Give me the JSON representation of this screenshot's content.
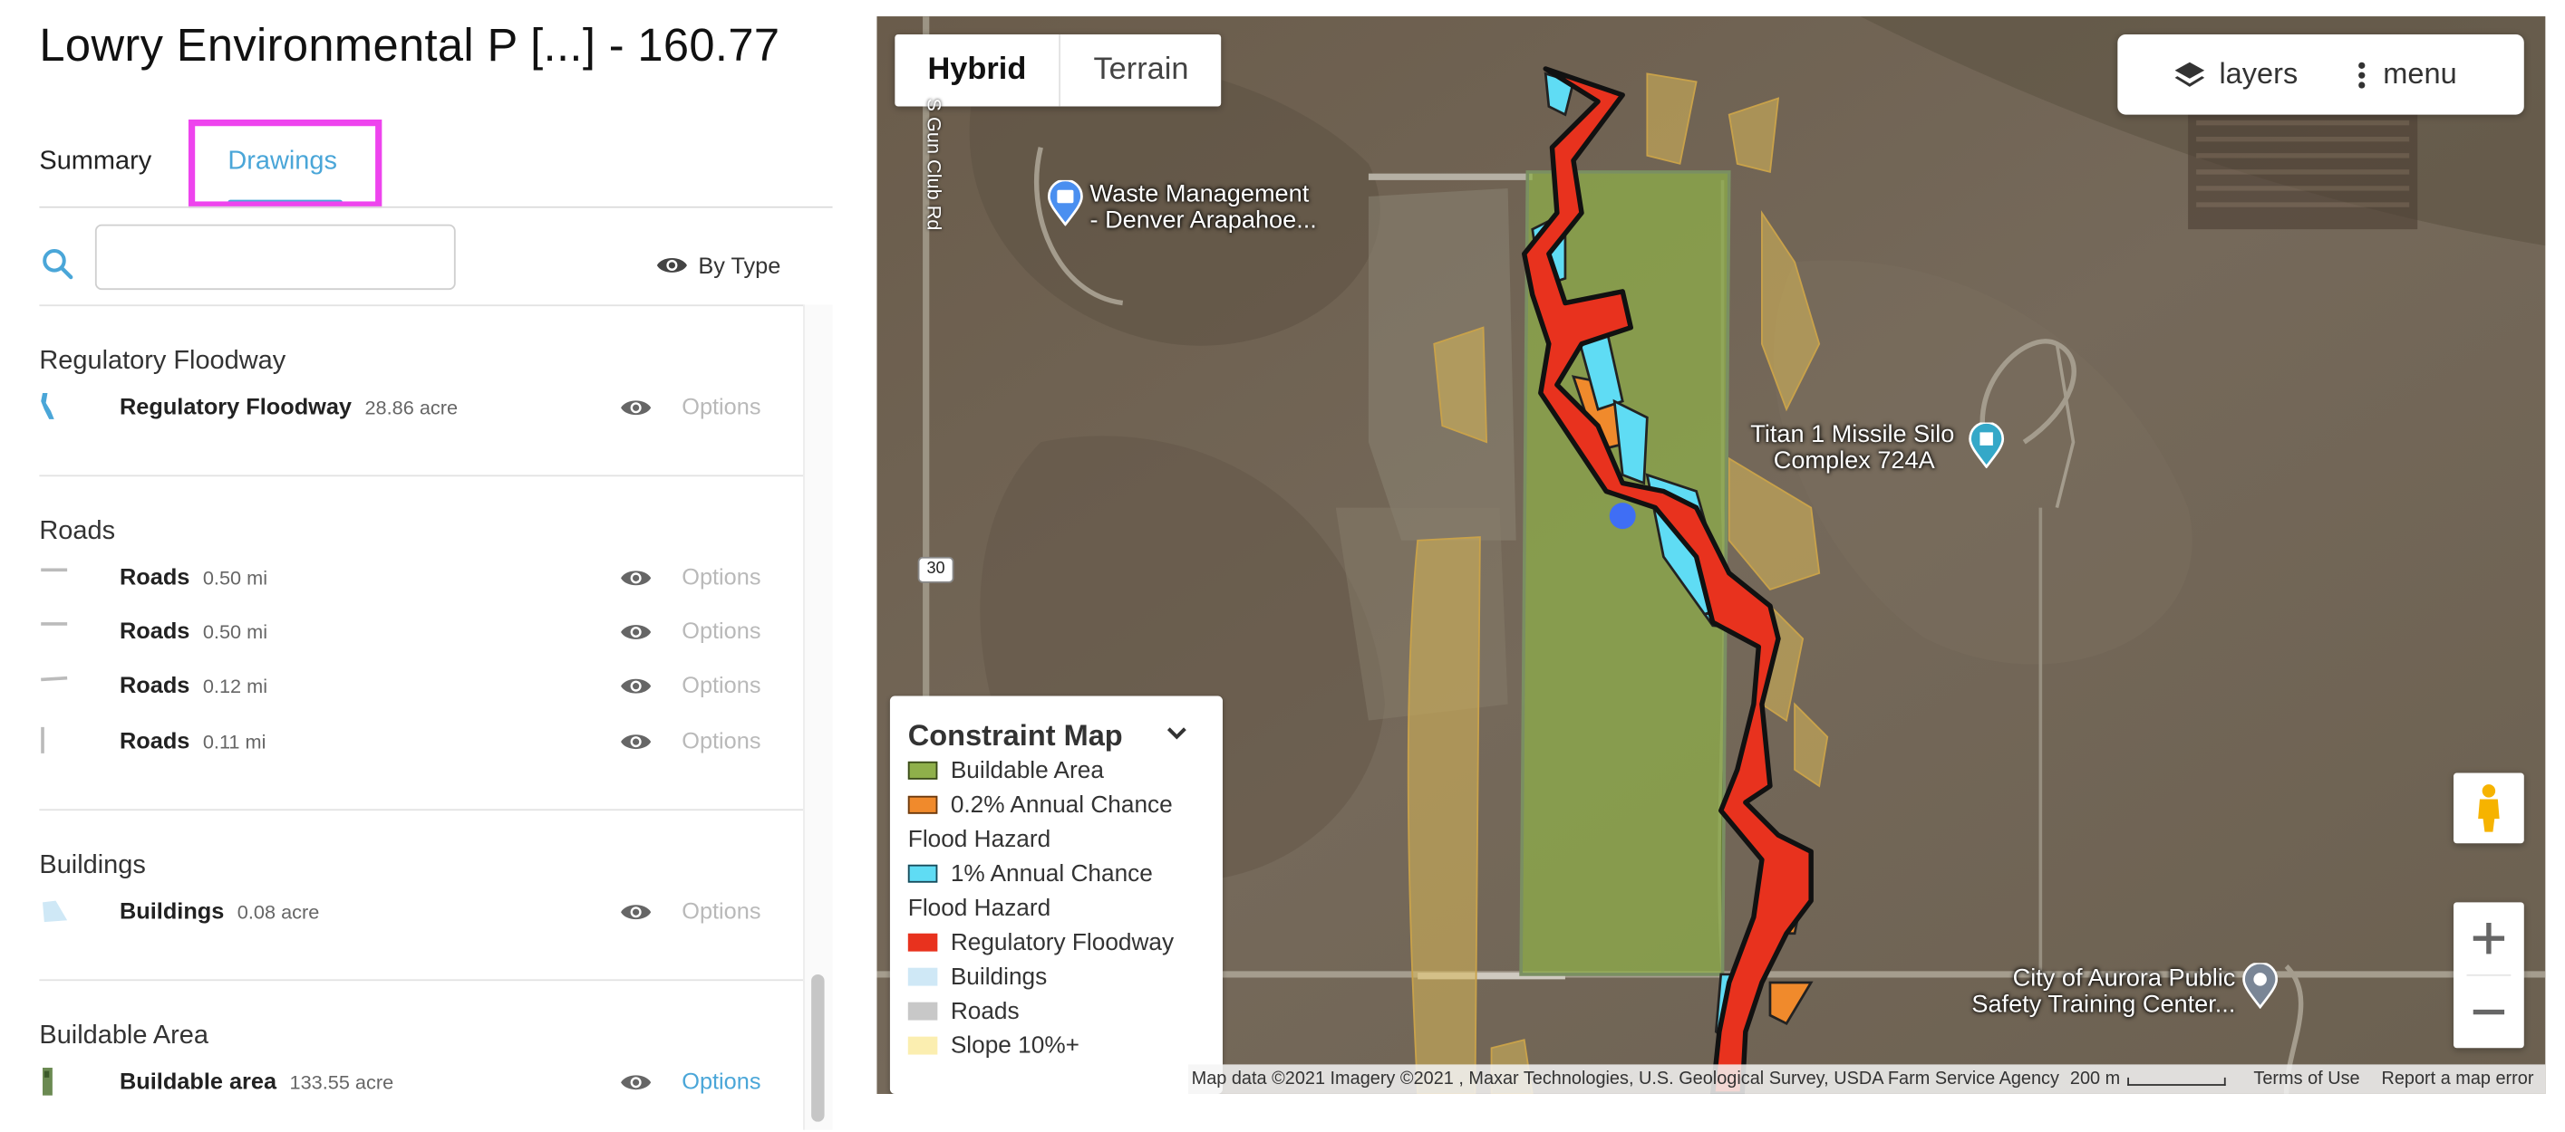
{
  "header": {
    "title": "Lowry Environmental P [...] - 160.77"
  },
  "tabs": [
    {
      "label": "Summary",
      "active": false
    },
    {
      "label": "Drawings",
      "active": true
    }
  ],
  "search": {
    "value": "",
    "placeholder": ""
  },
  "filter": {
    "label": "By Type"
  },
  "groups": {
    "floodway": {
      "title": "Regulatory Floodway",
      "rows": [
        {
          "name": "Regulatory Floodway",
          "measure": "28.86 acre",
          "options": "Options"
        }
      ]
    },
    "roads": {
      "title": "Roads",
      "rows": [
        {
          "name": "Roads",
          "measure": "0.50 mi",
          "options": "Options"
        },
        {
          "name": "Roads",
          "measure": "0.50 mi",
          "options": "Options"
        },
        {
          "name": "Roads",
          "measure": "0.12 mi",
          "options": "Options"
        },
        {
          "name": "Roads",
          "measure": "0.11 mi",
          "options": "Options"
        }
      ]
    },
    "buildings": {
      "title": "Buildings",
      "rows": [
        {
          "name": "Buildings",
          "measure": "0.08 acre",
          "options": "Options"
        }
      ]
    },
    "buildable": {
      "title": "Buildable Area",
      "rows": [
        {
          "name": "Buildable area",
          "measure": "133.55 acre",
          "options": "Options"
        }
      ]
    }
  },
  "map": {
    "map_types": [
      "Hybrid",
      "Terrain"
    ],
    "selected_map_type": "Hybrid",
    "layers_label": "layers",
    "menu_label": "menu",
    "labels": {
      "waste_line1": "Waste Management",
      "waste_line2": "- Denver Arapahoe...",
      "titan_line1": "Titan 1 Missile Silo",
      "titan_line2": "Complex 724A",
      "aurora_line1": "City of Aurora Public",
      "aurora_line2": "Safety Training Center...",
      "road_gunclub": "S Gun Club Rd",
      "route_shield": "30"
    },
    "legend": {
      "title": "Constraint Map",
      "items": [
        {
          "line1": "Buildable Area",
          "line2": "",
          "color": "#8fb04a",
          "border": "#3a4a1a"
        },
        {
          "line1": "0.2% Annual Chance",
          "line2": "Flood Hazard",
          "color": "#f08a2c",
          "border": "#6a3a10"
        },
        {
          "line1": "1% Annual Chance",
          "line2": "Flood Hazard",
          "color": "#5fdcf4",
          "border": "#1a4a5a"
        },
        {
          "line1": "Regulatory Floodway",
          "line2": "",
          "color": "#e8321e",
          "border": "#e8321e"
        },
        {
          "line1": "Buildings",
          "line2": "",
          "color": "#cfe8f6",
          "border": "#cfe8f6"
        },
        {
          "line1": "Roads",
          "line2": "",
          "color": "#c8c8c8",
          "border": "#c8c8c8"
        },
        {
          "line1": "Slope 10%+",
          "line2": "",
          "color": "#fbeeb0",
          "border": "#fbeeb0"
        }
      ]
    },
    "attribution": {
      "data": "Map data ©2021 Imagery ©2021 , Maxar Technologies, U.S. Geological Survey, USDA Farm Service Agency",
      "scale": "200 m",
      "terms": "Terms of Use",
      "report": "Report a map error"
    },
    "colors": {
      "buildable": "#8fb04a",
      "floodway": "#e8321e",
      "one_percent": "#5fdcf4",
      "point_two_percent": "#f08a2c",
      "slope": "#d9b85a",
      "accent": "#4aa6d8",
      "tab_highlight": "#ee44ee"
    }
  }
}
